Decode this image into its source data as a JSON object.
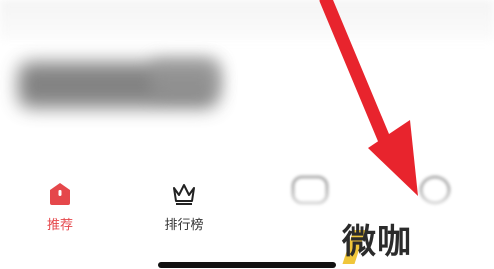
{
  "tabbar": {
    "items": [
      {
        "label": "推荐",
        "icon": "home-icon",
        "active": true
      },
      {
        "label": "排行榜",
        "icon": "crown-icon",
        "active": false
      }
    ]
  },
  "watermark": {
    "text": "微咖"
  },
  "colors": {
    "accent": "#e5474b",
    "arrow": "#e8242d",
    "text": "#333333"
  }
}
